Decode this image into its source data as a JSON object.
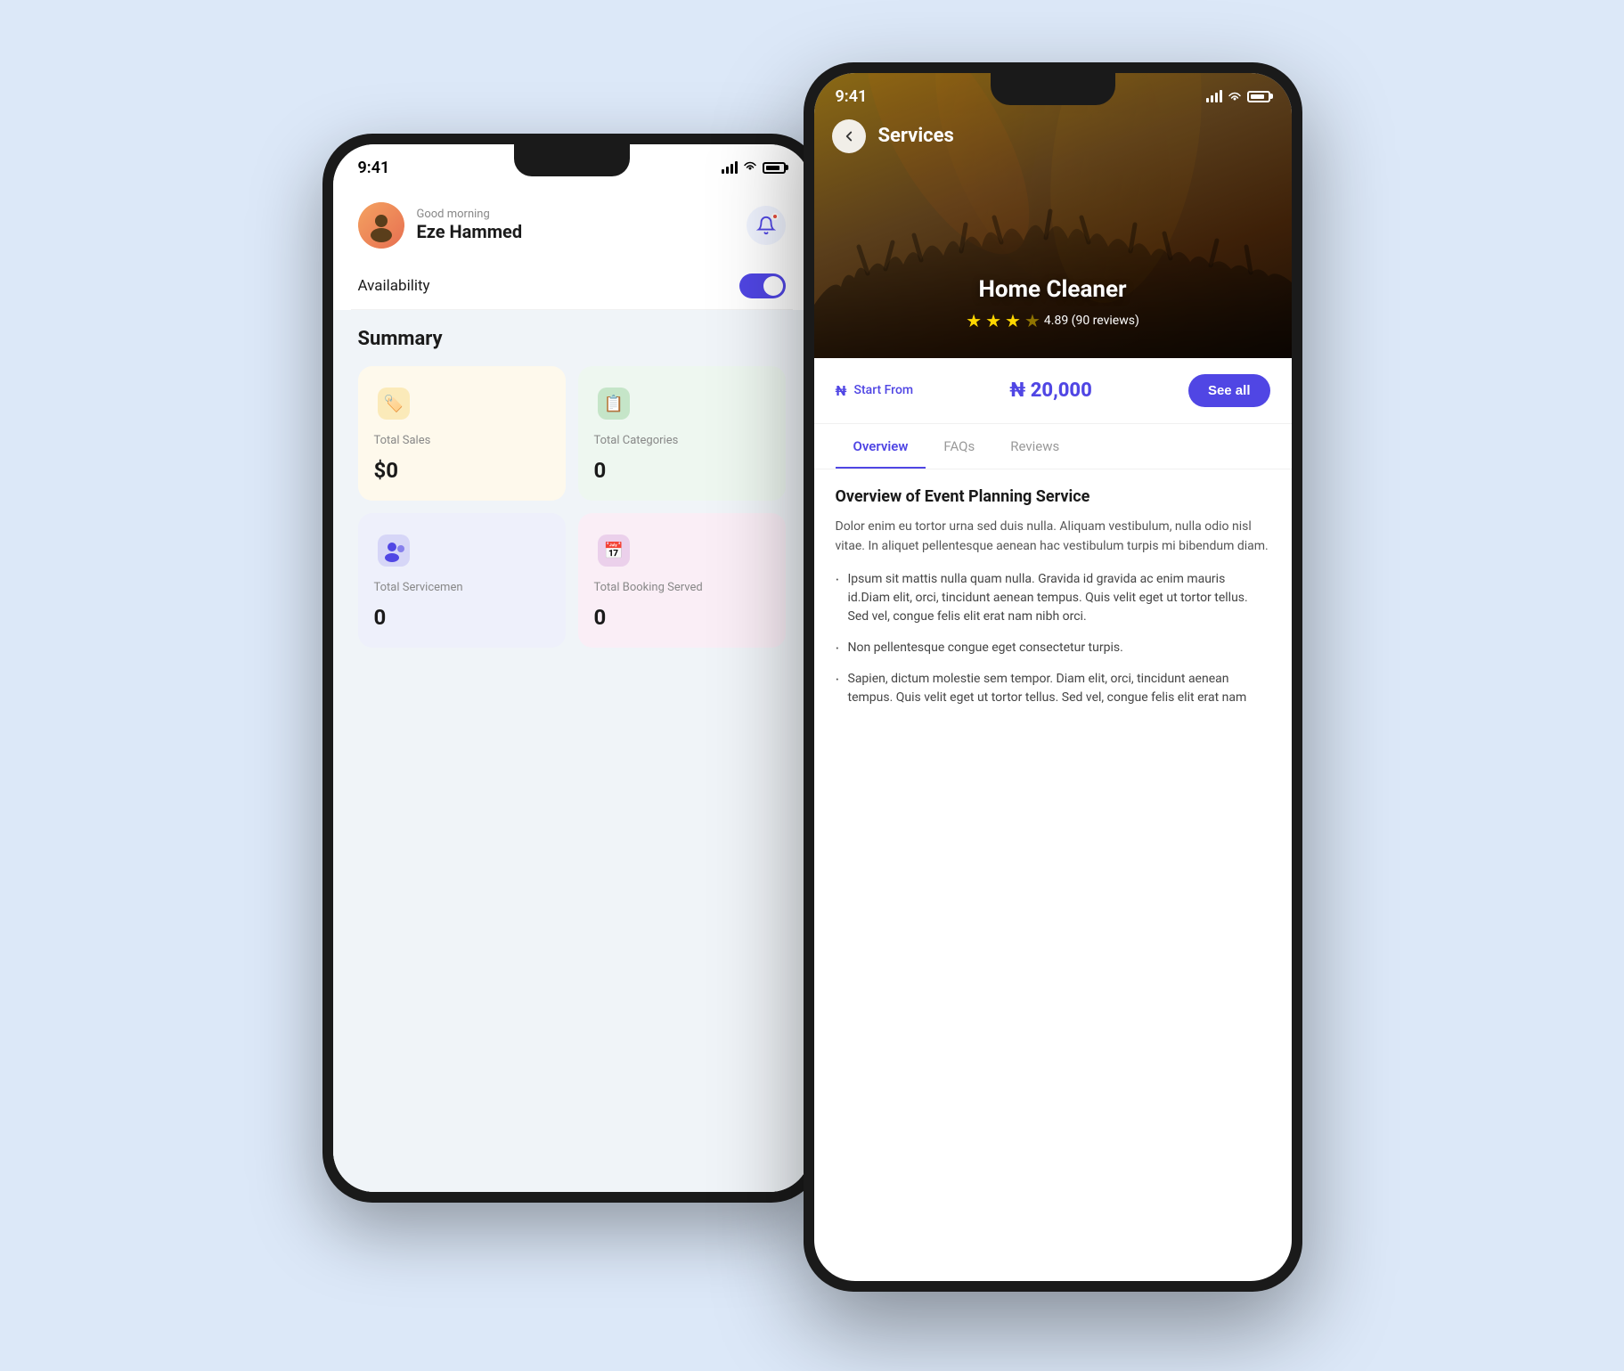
{
  "scene": {
    "bg_color": "#dce8f8"
  },
  "phone1": {
    "status_bar": {
      "time": "9:41"
    },
    "header": {
      "greeting": "Good morning",
      "user_name": "Eze Hammed"
    },
    "availability": {
      "label": "Availability"
    },
    "summary": {
      "title": "Summary",
      "cards": [
        {
          "id": "total-sales",
          "label": "Total Sales",
          "value": "$0",
          "color": "yellow",
          "icon": "🏷️"
        },
        {
          "id": "total-categories",
          "label": "Total Categories",
          "value": "0",
          "color": "green",
          "icon": "📋"
        },
        {
          "id": "total-servicemen",
          "label": "Total Servicemen",
          "value": "0",
          "color": "blue",
          "icon": "👤"
        },
        {
          "id": "total-booking",
          "label": "Total Booking Served",
          "value": "0",
          "color": "pink",
          "icon": "📅"
        }
      ]
    }
  },
  "phone2": {
    "status_bar": {
      "time": "9:41"
    },
    "header": {
      "back_label": "‹",
      "title": "Services"
    },
    "hero": {
      "service_name": "Home Cleaner",
      "rating": "4.89",
      "reviews": "90 reviews",
      "stars_count": 3.5
    },
    "price": {
      "start_from_label": "Start From",
      "amount": "₦ 20,000",
      "see_all_label": "See all"
    },
    "tabs": [
      {
        "id": "overview",
        "label": "Overview",
        "active": true
      },
      {
        "id": "faqs",
        "label": "FAQs",
        "active": false
      },
      {
        "id": "reviews",
        "label": "Reviews",
        "active": false
      }
    ],
    "overview": {
      "title": "Overview of Event Planning Service",
      "body": "Dolor enim eu tortor urna sed duis nulla. Aliquam vestibulum, nulla odio nisl vitae. In aliquet pellentesque aenean hac vestibulum turpis mi bibendum diam.",
      "bullets": [
        "Ipsum sit mattis nulla quam nulla. Gravida id gravida ac enim mauris id.Diam elit, orci, tincidunt aenean tempus. Quis velit eget ut tortor tellus. Sed vel, congue felis elit erat nam nibh orci.",
        "Non pellentesque congue eget consectetur turpis.",
        "Sapien, dictum molestie sem tempor. Diam elit, orci, tincidunt aenean tempus. Quis velit eget ut tortor tellus. Sed vel, congue felis elit erat nam"
      ]
    }
  }
}
